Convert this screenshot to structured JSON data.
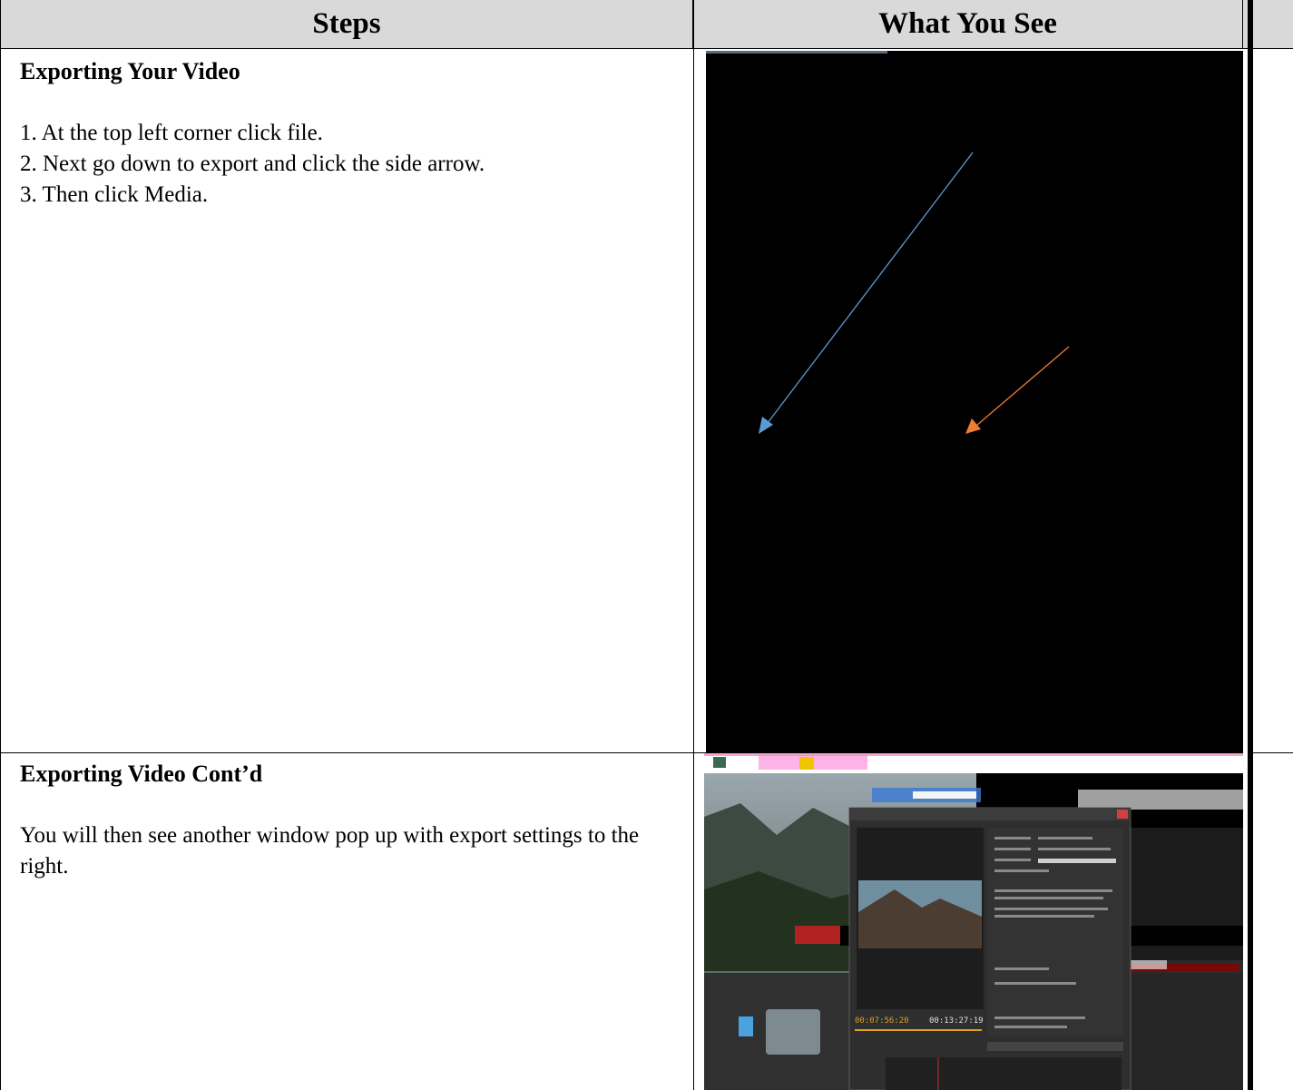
{
  "table": {
    "headers": {
      "steps": "Steps",
      "what_you_see": "What You See"
    }
  },
  "rows": [
    {
      "title": "Exporting Your Video",
      "steps": [
        "1. At the top left corner click file.",
        "2. Next go down to export and click the side arrow.",
        "3. Then click Media."
      ],
      "arrow_colors": {
        "blue": "#5b9bd5",
        "orange": "#ed7d31"
      }
    },
    {
      "title": "Exporting Video Cont’d",
      "body": "You will then see another window pop up with export settings to the right.",
      "dialog_timecodes": {
        "current": "00:07:56:20",
        "total": "00:13:27:19"
      }
    }
  ]
}
